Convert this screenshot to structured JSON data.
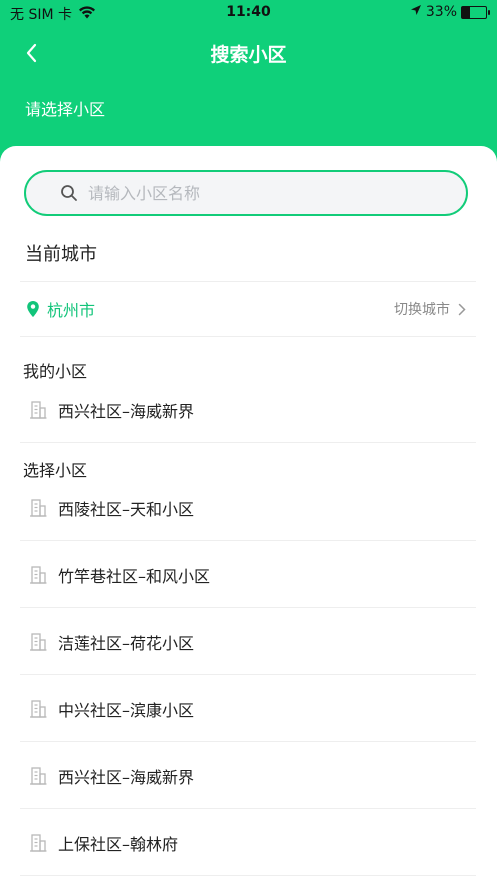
{
  "status_bar": {
    "carrier": "无 SIM 卡",
    "time": "11:40",
    "battery": "33%",
    "battery_level": 0.33
  },
  "header": {
    "back_icon": "chevron-left-icon",
    "title": "搜索小区",
    "subtitle": "请选择小区"
  },
  "search": {
    "placeholder": "请输入小区名称",
    "value": ""
  },
  "current_city": {
    "heading": "当前城市",
    "city": "杭州市",
    "switch_label": "切换城市"
  },
  "my_communities": {
    "label": "我的小区",
    "items": [
      "西兴社区–海威新界"
    ]
  },
  "select_communities": {
    "label": "选择小区",
    "items": [
      "西陵社区–天和小区",
      "竹竿巷社区–和风小区",
      "洁莲社区–荷花小区",
      "中兴社区–滨康小区",
      "西兴社区–海威新界",
      "上保社区–翰林府"
    ]
  },
  "colors": {
    "brand": "#0fd07a",
    "accent_text": "#12c47a"
  }
}
